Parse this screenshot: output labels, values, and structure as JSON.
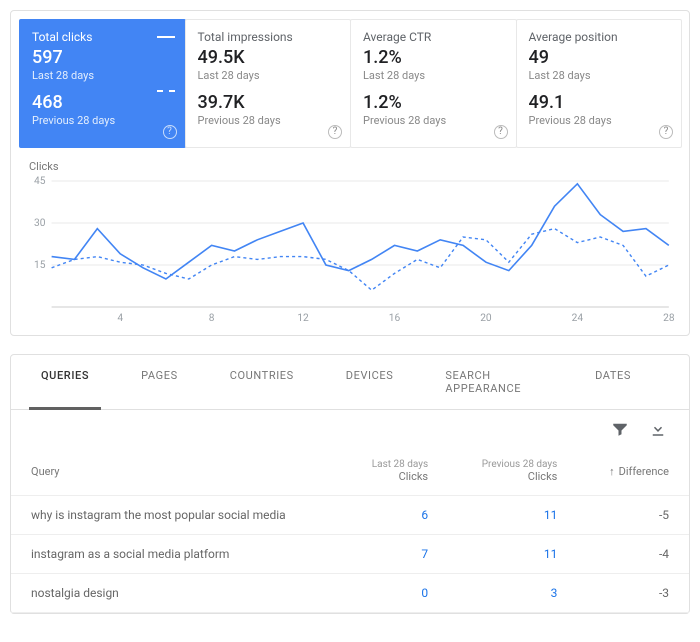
{
  "metrics": [
    {
      "title": "Total clicks",
      "value": "597",
      "period": "Last 28 days",
      "prev_value": "468",
      "prev_period": "Previous 28 days",
      "active": true
    },
    {
      "title": "Total impressions",
      "value": "49.5K",
      "period": "Last 28 days",
      "prev_value": "39.7K",
      "prev_period": "Previous 28 days"
    },
    {
      "title": "Average CTR",
      "value": "1.2%",
      "period": "Last 28 days",
      "prev_value": "1.2%",
      "prev_period": "Previous 28 days"
    },
    {
      "title": "Average position",
      "value": "49",
      "period": "Last 28 days",
      "prev_value": "49.1",
      "prev_period": "Previous 28 days"
    }
  ],
  "chart_data": {
    "type": "line",
    "title": "Clicks",
    "xlabel": "",
    "ylabel": "",
    "ylim": [
      0,
      45
    ],
    "y_ticks": [
      15,
      30,
      45
    ],
    "x": [
      1,
      2,
      3,
      4,
      5,
      6,
      7,
      8,
      9,
      10,
      11,
      12,
      13,
      14,
      15,
      16,
      17,
      18,
      19,
      20,
      21,
      22,
      23,
      24,
      25,
      26,
      27,
      28
    ],
    "x_ticks": [
      4,
      8,
      12,
      16,
      20,
      24,
      28
    ],
    "series": [
      {
        "name": "Last 28 days",
        "style": "solid",
        "values": [
          18,
          17,
          28,
          19,
          14,
          10,
          16,
          22,
          20,
          24,
          27,
          30,
          15,
          13,
          17,
          22,
          20,
          24,
          22,
          16,
          13,
          22,
          36,
          44,
          33,
          27,
          28,
          22
        ]
      },
      {
        "name": "Previous 28 days",
        "style": "dashed",
        "values": [
          14,
          17,
          18,
          16,
          15,
          12,
          10,
          15,
          18,
          17,
          18,
          18,
          17,
          13,
          6,
          12,
          17,
          14,
          25,
          24,
          16,
          26,
          28,
          23,
          25,
          22,
          11,
          15
        ]
      }
    ]
  },
  "tabs": [
    "QUERIES",
    "PAGES",
    "COUNTRIES",
    "DEVICES",
    "SEARCH APPEARANCE",
    "DATES"
  ],
  "active_tab": 0,
  "table": {
    "headers": {
      "query": "Query",
      "col1_top": "Last 28 days",
      "col1_sub": "Clicks",
      "col2_top": "Previous 28 days",
      "col2_sub": "Clicks",
      "diff": "Difference"
    },
    "rows": [
      {
        "q": "why is instagram the most popular social media",
        "a": "6",
        "b": "11",
        "d": "-5"
      },
      {
        "q": "instagram as a social media platform",
        "a": "7",
        "b": "11",
        "d": "-4"
      },
      {
        "q": "nostalgia design",
        "a": "0",
        "b": "3",
        "d": "-3"
      }
    ]
  }
}
